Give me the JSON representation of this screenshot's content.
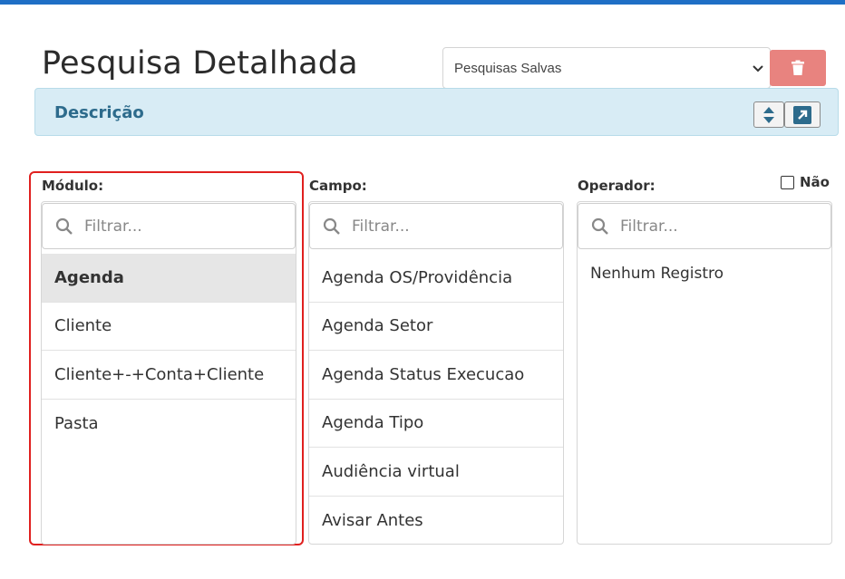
{
  "header": {
    "title": "Pesquisa Detalhada",
    "saved_searches": {
      "selected": "Pesquisas Salvas"
    }
  },
  "description_bar": {
    "label": "Descrição"
  },
  "columns": {
    "modulo": {
      "label": "Módulo:",
      "filter_placeholder": "Filtrar...",
      "items": [
        {
          "label": "Agenda",
          "selected": true
        },
        {
          "label": "Cliente",
          "selected": false
        },
        {
          "label": "Cliente+-+Conta+Cliente",
          "selected": false
        },
        {
          "label": "Pasta",
          "selected": false
        }
      ]
    },
    "campo": {
      "label": "Campo:",
      "filter_placeholder": "Filtrar...",
      "items": [
        {
          "label": "Agenda OS/Providência"
        },
        {
          "label": "Agenda Setor"
        },
        {
          "label": "Agenda Status Execucao"
        },
        {
          "label": "Agenda Tipo"
        },
        {
          "label": "Audiência virtual"
        },
        {
          "label": "Avisar Antes"
        }
      ]
    },
    "operador": {
      "label": "Operador:",
      "filter_placeholder": "Filtrar...",
      "empty_text": "Nenhum Registro",
      "negate": {
        "label": "Não",
        "checked": false
      }
    }
  },
  "icons": {
    "delete": "trash-icon",
    "sort": "sort-icon",
    "expand": "external-link-icon",
    "search": "search-icon",
    "dropdown": "chevron-down-icon"
  },
  "colors": {
    "accent": "#1f6fc5",
    "danger": "#e8837f",
    "info_bg": "#d8ecf5",
    "info_text": "#2d6b8c",
    "highlight": "#e0201f"
  }
}
